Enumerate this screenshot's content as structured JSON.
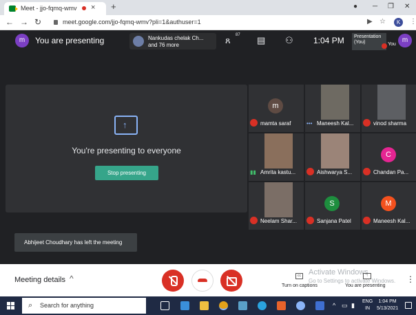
{
  "browser": {
    "tab_title": "Meet - jjo-fqmq-wmv",
    "new_tab": "+",
    "url": "meet.google.com/jjo-fqmq-wmv?pli=1&authuser=1",
    "profile_initial": "K"
  },
  "meet_header": {
    "user_initial": "m",
    "presenting_label": "You are presenting",
    "chip_line1": "Nankudas chelak Ch...",
    "chip_line2": "and 76 more",
    "people_count": "87",
    "time": "1:04 PM",
    "thumb_line1": "Presentation",
    "thumb_line2": "(You)",
    "you_label": "You",
    "you_initial": "m"
  },
  "stage": {
    "title": "You're presenting to everyone",
    "stop_button": "Stop presenting"
  },
  "participants": [
    {
      "name": "mamta saraf",
      "initial": "m",
      "color": "#5f4b43",
      "kind": "avatar",
      "status": "muted"
    },
    {
      "name": "Maneesh Kal...",
      "kind": "photo",
      "tone": "a",
      "status": "speaking"
    },
    {
      "name": "vinod sharma",
      "kind": "photo",
      "tone": "c",
      "status": "muted"
    },
    {
      "name": "Amrita kastu...",
      "kind": "photo",
      "tone": "b",
      "status": "talking"
    },
    {
      "name": "Aishwarya S...",
      "kind": "photo",
      "tone": "d",
      "status": "muted"
    },
    {
      "name": "Chandan Pa...",
      "initial": "C",
      "color": "#e52592",
      "kind": "avatar",
      "status": "muted"
    },
    {
      "name": "Neelam Shar...",
      "kind": "photo",
      "tone": "e",
      "status": "muted"
    },
    {
      "name": "Sanjana Patel",
      "initial": "S",
      "color": "#1e8e3e",
      "kind": "avatar",
      "status": "muted"
    },
    {
      "name": "Maneesh Kal...",
      "initial": "M",
      "color": "#f4511e",
      "kind": "avatar",
      "status": "muted"
    }
  ],
  "toast": "Abhijeet Choudhary has left the meeting",
  "bottom_bar": {
    "meeting_details": "Meeting details",
    "cc_glyph": "cc",
    "captions_label": "Turn on captions",
    "presenting_label": "You are presenting",
    "watermark_line1": "Activate Windows",
    "watermark_line2": "Go to Settings to activate Windows."
  },
  "taskbar": {
    "search_placeholder": "Search for anything",
    "lang_line1": "ENG",
    "lang_line2": "IN",
    "time": "1:04 PM",
    "date": "5/13/2021"
  },
  "colors": {
    "meet_bg": "#202124",
    "tile_bg": "#303134",
    "accent_green": "#36a58a",
    "danger_red": "#d93025",
    "taskbar_bg": "#1f2a44"
  }
}
